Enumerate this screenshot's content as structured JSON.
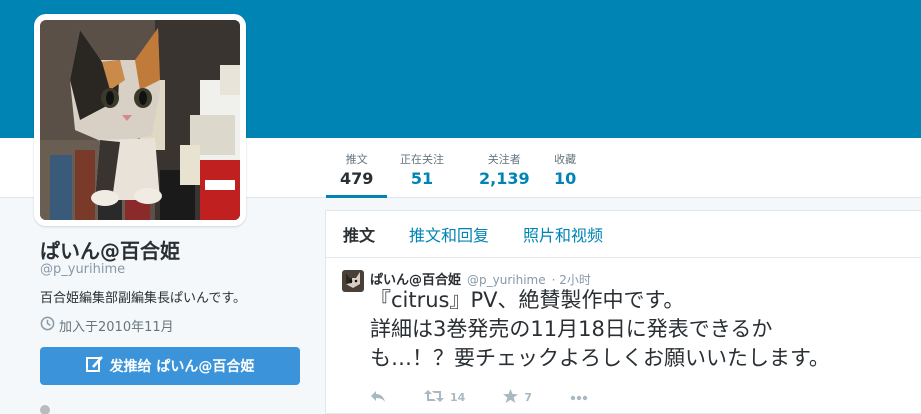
{
  "profile": {
    "name": "ぱいん@百合姫",
    "handle": "@p_yurihime",
    "bio": "百合姫編集部副編集長ぱいんです。",
    "joined": "加入于2010年11月",
    "tweet_to_button": "发推给 ぱいん@百合姫"
  },
  "stats": [
    {
      "label": "推文",
      "value": "479"
    },
    {
      "label": "正在关注",
      "value": "51"
    },
    {
      "label": "关注者",
      "value": "2,139"
    },
    {
      "label": "收藏",
      "value": "10"
    }
  ],
  "tabs": [
    "推文",
    "推文和回复",
    "照片和视频"
  ],
  "tweet": {
    "author": "ぱいん@百合姫",
    "handle": "@p_yurihime",
    "time": "· 2小时",
    "text": "『citrus』PV、絶賛製作中です。\n詳細は3巻発売の11月18日に発表できるか\nも…！？要チェックよろしくお願いいたします。",
    "retweets": "14",
    "favorites": "7"
  },
  "icons": [
    "clock-icon",
    "compose-icon",
    "reply-icon",
    "retweet-icon",
    "star-icon",
    "more-icon"
  ],
  "colors": {
    "banner": "#0084b4",
    "accent": "#3b94d9",
    "link": "#0084b4"
  }
}
